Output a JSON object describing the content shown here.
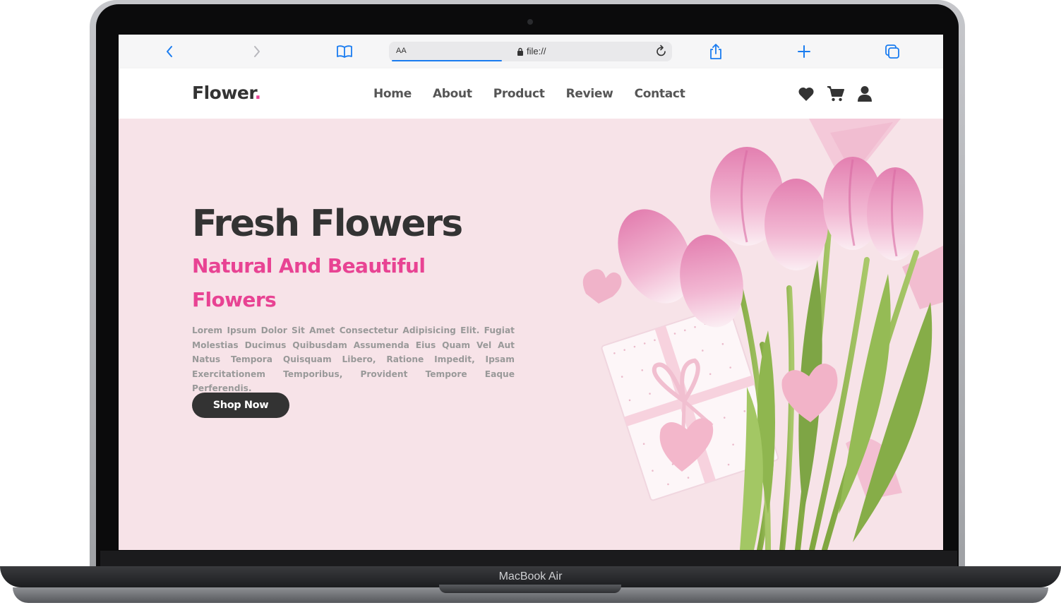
{
  "device": {
    "label": "MacBook Air"
  },
  "browser": {
    "url_text_size_label": "AA",
    "url": "file://",
    "icons": [
      "back-icon",
      "forward-icon",
      "bookmarks-icon",
      "lock-icon",
      "reload-icon",
      "share-icon",
      "new-tab-icon",
      "tabs-icon"
    ],
    "accent_color": "#1a7cf0"
  },
  "site": {
    "logo_text": "Flower",
    "logo_dot": ".",
    "nav": [
      {
        "label": "Home"
      },
      {
        "label": "About"
      },
      {
        "label": "Product"
      },
      {
        "label": "Review"
      },
      {
        "label": "Contact"
      }
    ],
    "header_icons": [
      "heart-icon",
      "cart-icon",
      "user-icon"
    ]
  },
  "hero": {
    "title": "Fresh Flowers",
    "subtitle": "Natural And Beautiful Flowers",
    "description": "Lorem Ipsum Dolor Sit Amet Consectetur Adipisicing Elit. Fugiat Molestias Ducimus Quibusdam Assumenda Eius Quam Vel Aut Natus Tempora Quisquam Libero, Ratione Impedit, Ipsam Exercitationem Temporibus, Provident Tempore Eaque Perferendis.",
    "button_label": "Shop Now"
  },
  "colors": {
    "brand_pink": "#e84393",
    "text_dark": "#333333",
    "hero_background": "#f7e3e8"
  }
}
